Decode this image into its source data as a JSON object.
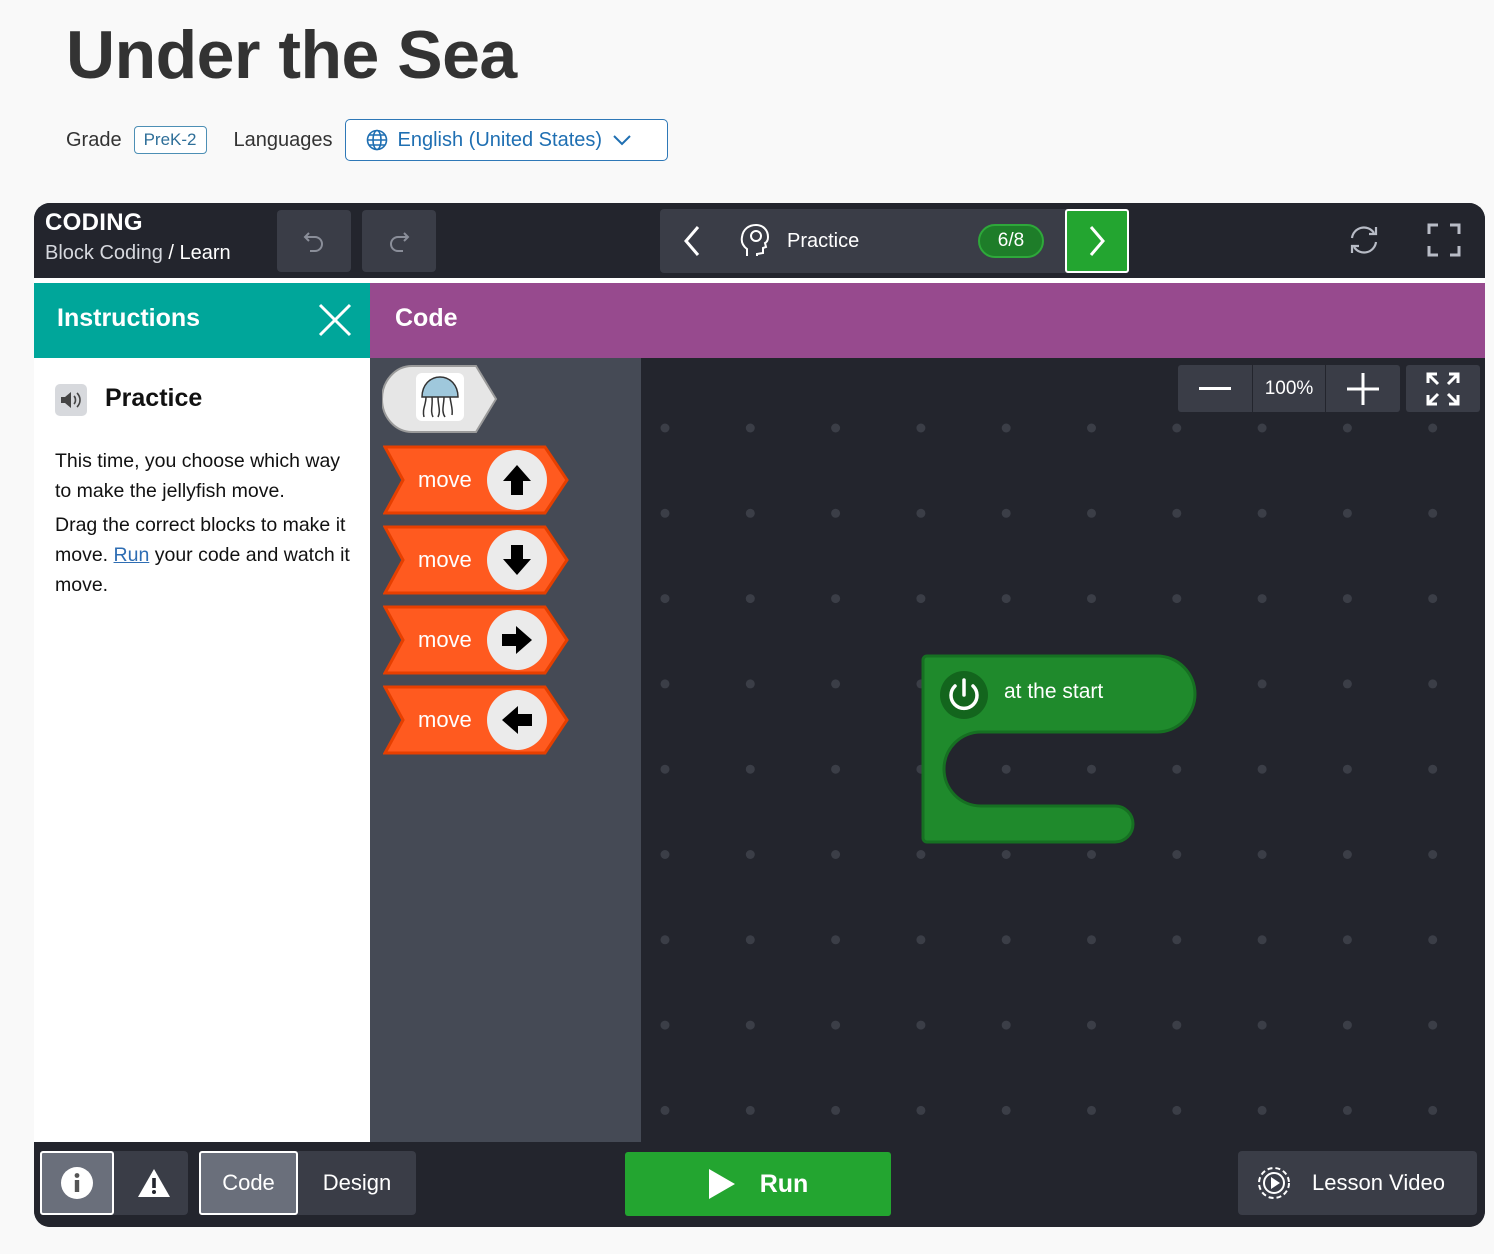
{
  "page": {
    "title": "Under the Sea",
    "grade_label": "Grade",
    "grade_value": "PreK-2",
    "languages_label": "Languages",
    "language_selected": "English (United States)"
  },
  "app": {
    "brand_title": "CODING",
    "breadcrumb_parent": "Block Coding",
    "breadcrumb_separator": "/",
    "breadcrumb_current": "Learn",
    "step_label": "Practice",
    "step_counter": "6/8"
  },
  "instructions": {
    "header": "Instructions",
    "title": "Practice",
    "paragraph1": "This time, you choose which way to make the jellyfish move.",
    "paragraph2_before": "Drag the correct blocks to make it move. ",
    "paragraph2_link": "Run",
    "paragraph2_after": " your code and watch it move."
  },
  "code": {
    "header": "Code",
    "blocks": [
      {
        "label": "move",
        "direction": "up"
      },
      {
        "label": "move",
        "direction": "down"
      },
      {
        "label": "move",
        "direction": "right"
      },
      {
        "label": "move",
        "direction": "left"
      }
    ],
    "start_block_label": "at the start",
    "zoom_level": "100%"
  },
  "bottom": {
    "code_tab": "Code",
    "design_tab": "Design",
    "run_label": "Run",
    "lesson_video_label": "Lesson Video"
  },
  "colors": {
    "teal": "#00a69a",
    "purple": "#974a8e",
    "green": "#23a530",
    "orange": "#ff5a1f",
    "dark": "#23252d"
  }
}
